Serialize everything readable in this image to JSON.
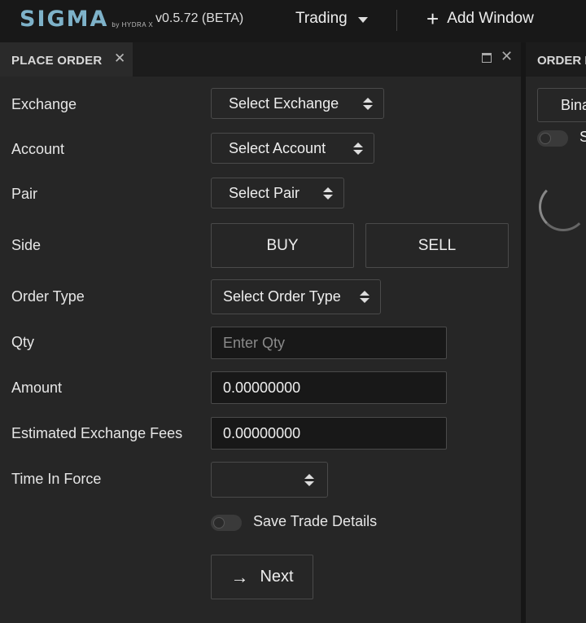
{
  "app": {
    "brand": "SIGMA",
    "brand_sub": "by HYDRA X",
    "version": "v0.5.72 (BETA)",
    "workspace": "Trading",
    "add_window": "Add Window"
  },
  "place_order": {
    "tab_title": "PLACE ORDER",
    "fields": {
      "exchange_label": "Exchange",
      "exchange_value": "Select Exchange",
      "account_label": "Account",
      "account_value": "Select Account",
      "pair_label": "Pair",
      "pair_value": "Select Pair",
      "side_label": "Side",
      "buy_label": "BUY",
      "sell_label": "SELL",
      "order_type_label": "Order Type",
      "order_type_value": "Select Order Type",
      "qty_label": "Qty",
      "qty_placeholder": "Enter Qty",
      "qty_value": "",
      "amount_label": "Amount",
      "amount_value": "0.00000000",
      "fees_label": "Estimated Exchange Fees",
      "fees_value": "0.00000000",
      "tif_label": "Time In Force",
      "tif_value": ""
    },
    "save_trade_details": "Save Trade Details",
    "save_trade_details_on": false,
    "next_label": "Next"
  },
  "order_panel": {
    "tab_title": "ORDER B",
    "exchange_value": "Bina",
    "toggle_label": "S",
    "toggle_on": false
  },
  "icons": {
    "add": "plus-icon",
    "workspace_dropdown": "chevron-down-icon",
    "tab_close": "close-icon",
    "maximize": "maximize-icon",
    "select_arrows": "up-down-arrows-icon",
    "next": "arrow-right-icon",
    "loading": "loading-spinner-icon"
  }
}
